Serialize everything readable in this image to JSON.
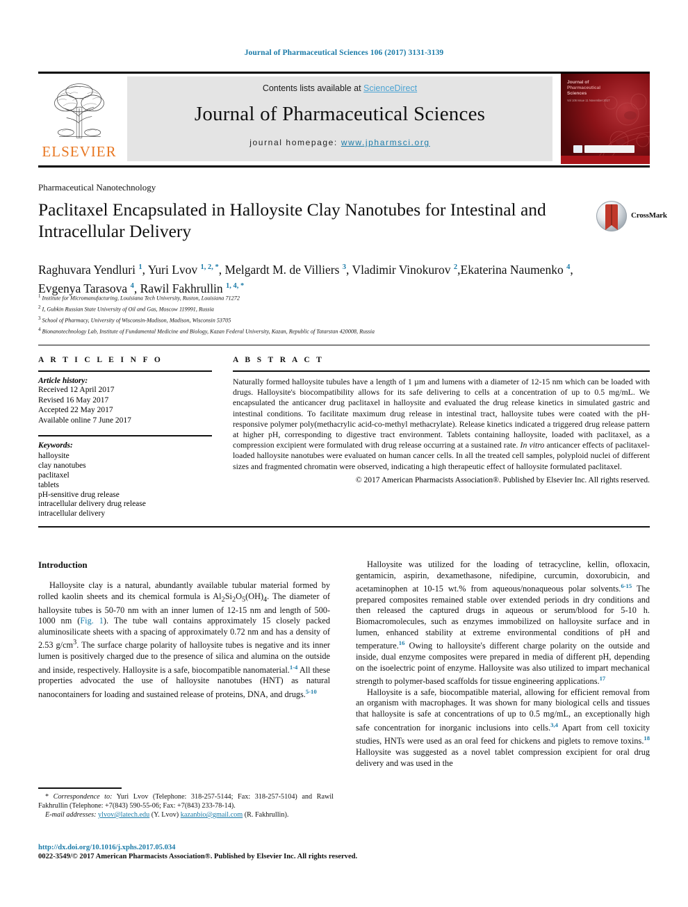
{
  "running_head": "Journal of Pharmaceutical Sciences 106 (2017) 3131-3139",
  "masthead": {
    "contents_prefix": "Contents lists available at ",
    "sciencedirect": "ScienceDirect",
    "journal_name": "Journal of Pharmaceutical Sciences",
    "homepage_prefix": "journal homepage: ",
    "homepage_url": "www.jpharmsci.org",
    "publisher": "ELSEVIER",
    "cover_title_line1": "Journal of",
    "cover_title_line2": "Pharmaceutical",
    "cover_title_line3": "Sciences",
    "cover_subtitle": "Vol 106  Issue 11  November 2017"
  },
  "article": {
    "section_label": "Pharmaceutical Nanotechnology",
    "title": "Paclitaxel Encapsulated in Halloysite Clay Nanotubes for Intestinal and Intracellular Delivery",
    "crossmark_label": "CrossMark",
    "authors": [
      {
        "name": "Raghuvara Yendluri",
        "sup": "1",
        "star": false,
        "sep": ", "
      },
      {
        "name": "Yuri Lvov",
        "sup": "1, 2,",
        "star": true,
        "sep": ", "
      },
      {
        "name": "Melgardt M. de Villiers",
        "sup": "3",
        "star": false,
        "sep": ", "
      },
      {
        "name": "Vladimir Vinokurov",
        "sup": "2",
        "star": false,
        "sep": ","
      },
      {
        "name": "Ekaterina Naumenko",
        "sup": "4",
        "star": false,
        "sep": ", "
      },
      {
        "name": "Evgenya Tarasova",
        "sup": "4",
        "star": false,
        "sep": ", "
      },
      {
        "name": "Rawil Fakhrullin",
        "sup": "1, 4,",
        "star": true,
        "sep": ""
      }
    ],
    "affiliations": [
      {
        "marker": "1",
        "text": "Institute for Micromanufacturing, Louisiana Tech University, Ruston, Louisiana 71272"
      },
      {
        "marker": "2",
        "text": "I, Gubkin Russian State University of Oil and Gas, Moscow 119991, Russia"
      },
      {
        "marker": "3",
        "text": "School of Pharmacy, University of Wisconsin-Madison, Madison, Wisconsin 53705"
      },
      {
        "marker": "4",
        "text": "Bionanotechnology Lab, Institute of Fundamental Medicine and Biology, Kazan Federal University, Kazan, Republic of Tatarstan 420008, Russia"
      }
    ]
  },
  "article_info": {
    "heading": "A R T I C L E  I N F O",
    "history_label": "Article history:",
    "history": [
      "Received 12 April 2017",
      "Revised 16 May 2017",
      "Accepted 22 May 2017",
      "Available online 7 June 2017"
    ],
    "keywords_label": "Keywords:",
    "keywords": [
      "halloysite",
      "clay nanotubes",
      "paclitaxel",
      "tablets",
      "pH-sensitive drug release",
      "intracellular delivery drug release",
      "intracellular delivery"
    ]
  },
  "abstract": {
    "heading": "A B S T R A C T",
    "text": "Naturally formed halloysite tubules have a length of 1 µm and lumens with a diameter of 12-15 nm which can be loaded with drugs. Halloysite's biocompatibility allows for its safe delivering to cells at a concentration of up to 0.5 mg/mL. We encapsulated the anticancer drug paclitaxel in halloysite and evaluated the drug release kinetics in simulated gastric and intestinal conditions. To facilitate maximum drug release in intestinal tract, halloysite tubes were coated with the pH-responsive polymer poly(methacrylic acid-co-methyl methacrylate). Release kinetics indicated a triggered drug release pattern at higher pH, corresponding to digestive tract environment. Tablets containing halloysite, loaded with paclitaxel, as a compression excipient were formulated with drug release occurring at a sustained rate. In vitro anticancer effects of paclitaxel-loaded halloysite nanotubes were evaluated on human cancer cells. In all the treated cell samples, polyploid nuclei of different sizes and fragmented chromatin were observed, indicating a high therapeutic effect of halloysite formulated paclitaxel.",
    "copyright": "© 2017 American Pharmacists Association®. Published by Elsevier Inc. All rights reserved."
  },
  "body": {
    "intro_heading": "Introduction",
    "left_paragraphs": [
      "Halloysite clay is a natural, abundantly available tubular material formed by rolled kaolin sheets and its chemical formula is Al2Si2O5(OH)4. The diameter of halloysite tubes is 50-70 nm with an inner lumen of 12-15 nm and length of 500-1000 nm (Fig. 1). The tube wall contains approximately 15 closely packed aluminosilicate sheets with a spacing of approximately 0.72 nm and has a density of 2.53 g/cm3. The surface charge polarity of halloysite tubes is negative and its inner lumen is positively charged due to the presence of silica and alumina on the outside and inside, respectively. Halloysite is a safe, biocompatible nanomaterial.1-4 All these properties advocated the use of halloysite nanotubes (HNT) as natural nanocontainers for loading and sustained release of proteins, DNA, and drugs.5-10"
    ],
    "right_paragraphs": [
      "Halloysite was utilized for the loading of tetracycline, kellin, ofloxacin, gentamicin, aspirin, dexamethasone, nifedipine, curcumin, doxorubicin, and acetaminophen at 10-15 wt.% from aqueous/nonaqueous polar solvents.6-15 The prepared composites remained stable over extended periods in dry conditions and then released the captured drugs in aqueous or serum/blood for 5-10 h. Biomacromolecules, such as enzymes immobilized on halloysite surface and in lumen, enhanced stability at extreme environmental conditions of pH and temperature.16 Owing to halloysite's different charge polarity on the outside and inside, dual enzyme composites were prepared in media of different pH, depending on the isoelectric point of enzyme. Halloysite was also utilized to impart mechanical strength to polymer-based scaffolds for tissue engineering applications.17",
      "Halloysite is a safe, biocompatible material, allowing for efficient removal from an organism with macrophages. It was shown for many biological cells and tissues that halloysite is safe at concentrations of up to 0.5 mg/mL, an exceptionally high safe concentration for inorganic inclusions into cells.3,4 Apart from cell toxicity studies, HNTs were used as an oral feed for chickens and piglets to remove toxins.18 Halloysite was suggested as a novel tablet compression excipient for oral drug delivery and was used in the"
    ]
  },
  "footnote": {
    "correspondence_label": "Correspondence to:",
    "correspondence_text": " Yuri Lvov (Telephone: 318-257-5144; Fax: 318-257-5104) and Rawil Fakhrullin (Telephone: +7(843) 590-55-06; Fax: +7(843) 233-78-14).",
    "email_label": "E-mail addresses:",
    "email1": "ylvov@latech.edu",
    "email1_owner": "(Y. Lvov)",
    "email2": "kazanbio@gmail.com",
    "email2_owner": "(R. Fakhrullin)."
  },
  "footer": {
    "doi": "http://dx.doi.org/10.1016/j.xphs.2017.05.034",
    "copyright": "0022-3549/© 2017 American Pharmacists Association®. Published by Elsevier Inc. All rights reserved."
  },
  "colors": {
    "link": "#1b7ba8",
    "sciencedirect": "#4ba3d3",
    "elsevier_orange": "#E87722",
    "crossmark_red": "#c0392b"
  }
}
